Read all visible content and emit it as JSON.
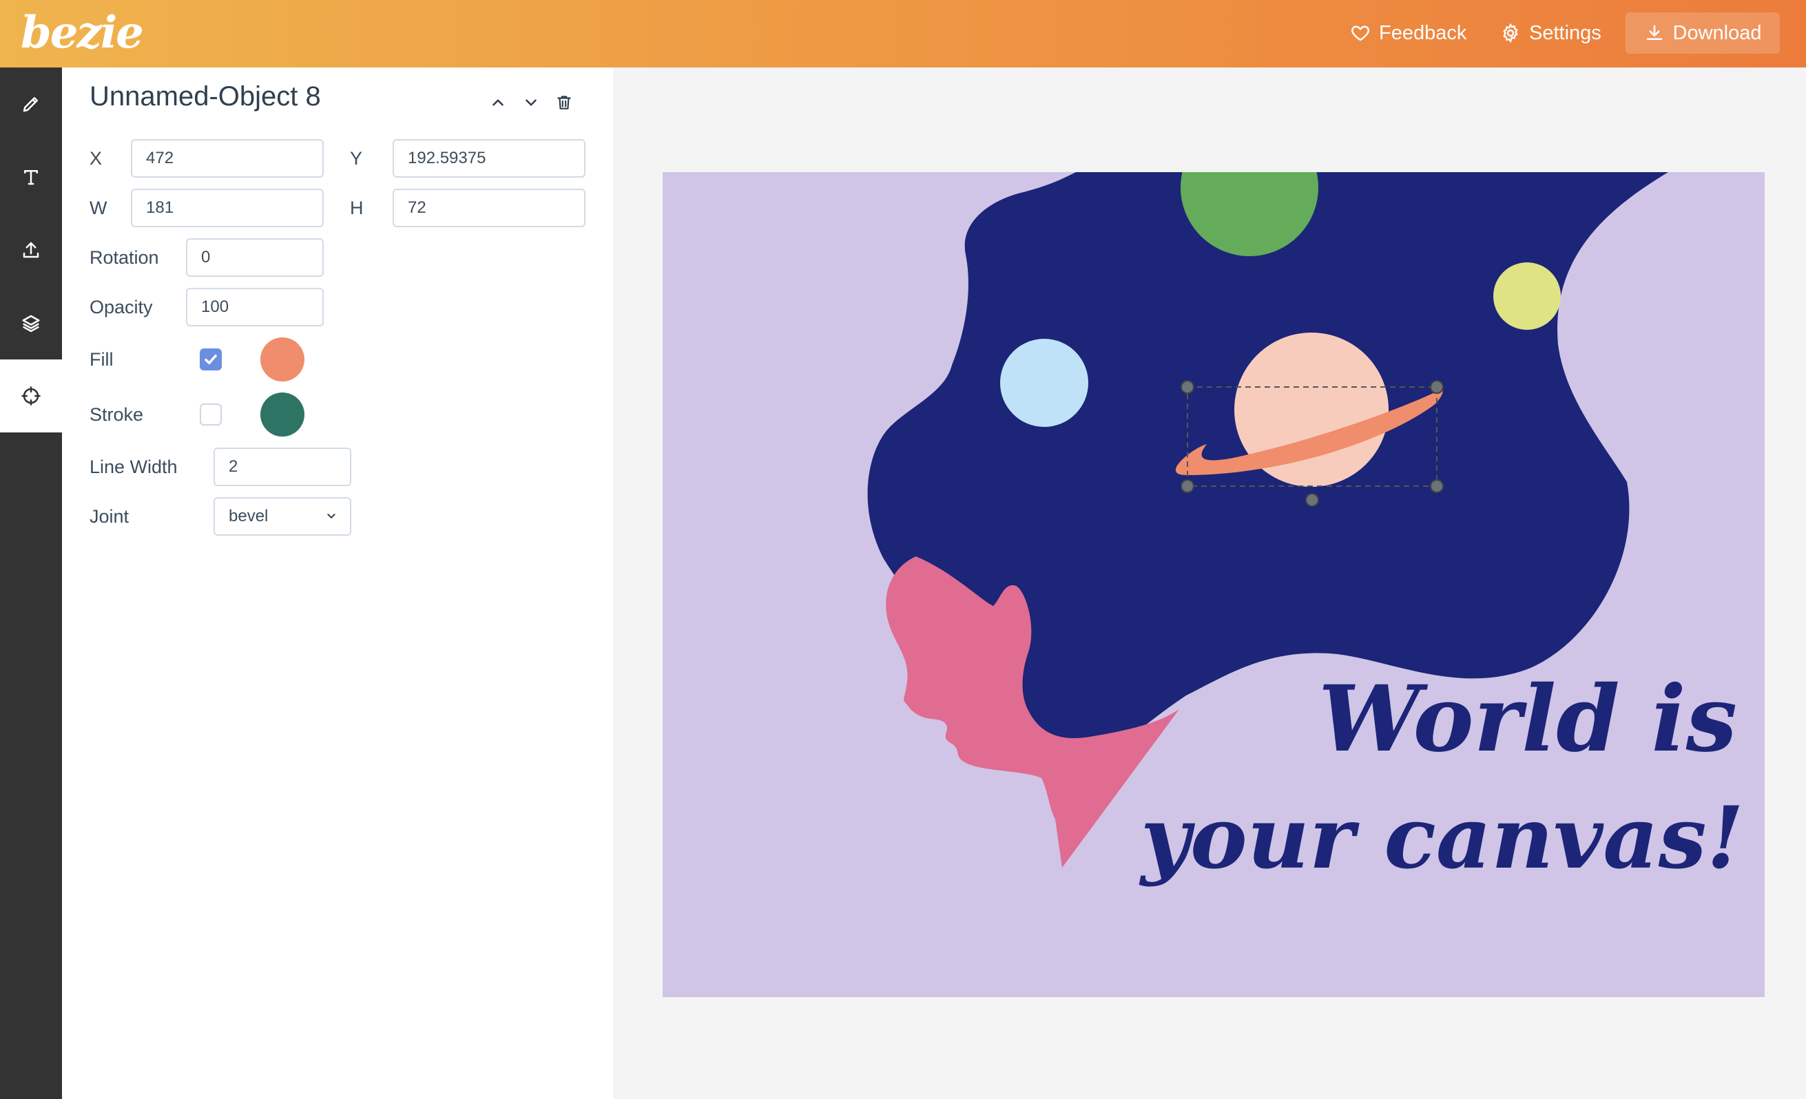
{
  "header": {
    "logo": "bezie",
    "feedback_label": "Feedback",
    "settings_label": "Settings",
    "download_label": "Download"
  },
  "rail": {
    "items": [
      {
        "name": "pencil-icon"
      },
      {
        "name": "text-icon"
      },
      {
        "name": "upload-icon"
      },
      {
        "name": "layers-icon"
      },
      {
        "name": "crosshair-icon",
        "active": true
      }
    ]
  },
  "panel": {
    "title": "Unnamed-Object 8",
    "x_label": "X",
    "x_value": "472",
    "y_label": "Y",
    "y_value": "192.59375",
    "w_label": "W",
    "w_value": "181",
    "h_label": "H",
    "h_value": "72",
    "rotation_label": "Rotation",
    "rotation_value": "0",
    "opacity_label": "Opacity",
    "opacity_value": "100",
    "fill_label": "Fill",
    "fill_checked": true,
    "fill_color": "#f08d6c",
    "stroke_label": "Stroke",
    "stroke_checked": false,
    "stroke_color": "#2e7465",
    "line_width_label": "Line Width",
    "line_width_value": "2",
    "joint_label": "Joint",
    "joint_value": "bevel"
  },
  "canvas": {
    "text_line1": "World is",
    "text_line2": "your canvas!",
    "background_color": "#d0c5e7",
    "hair_color": "#1c2577",
    "face_color": "#e06c91",
    "text_color": "#1c2577"
  }
}
